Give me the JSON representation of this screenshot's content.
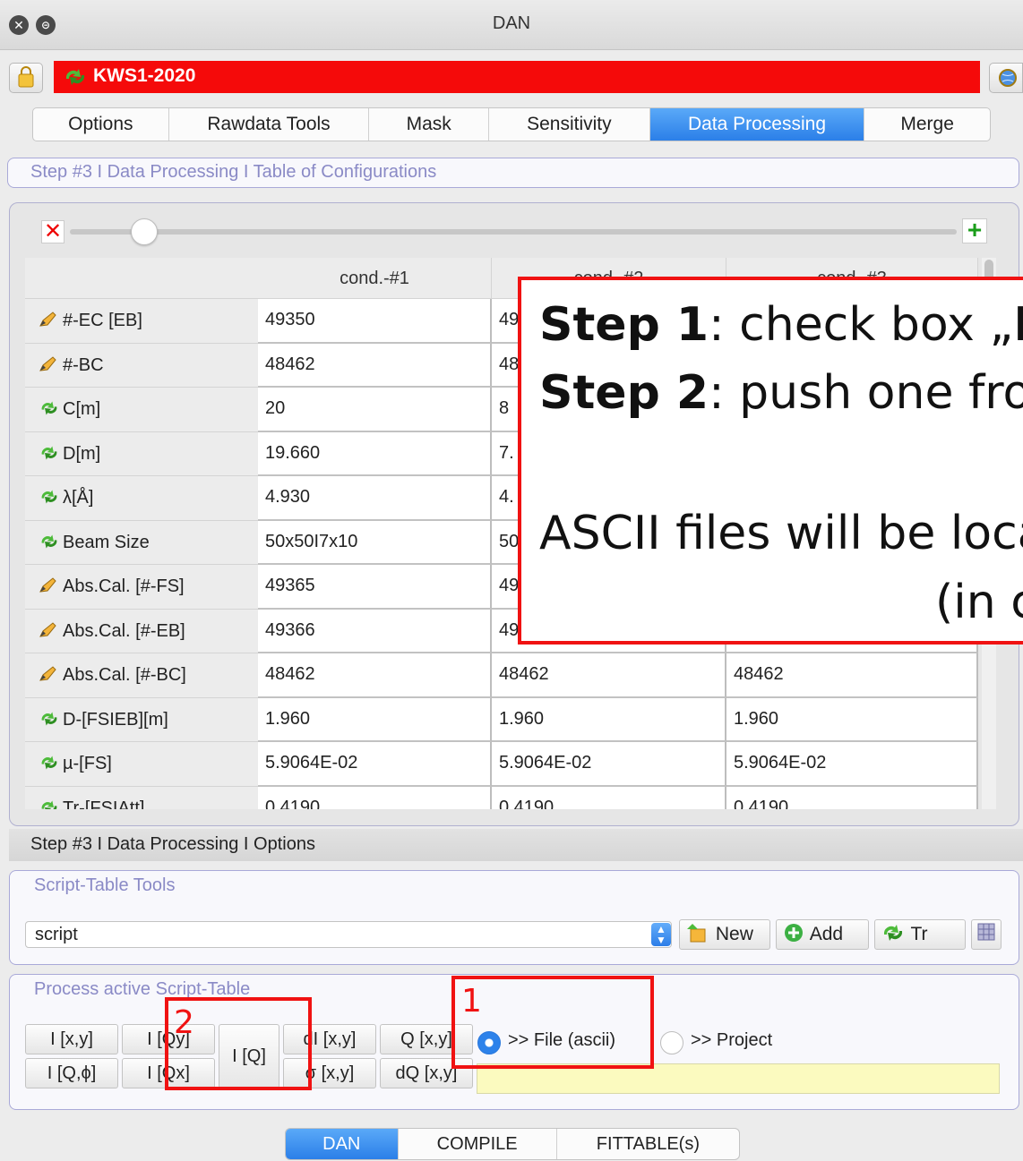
{
  "window": {
    "title": "DAN"
  },
  "project": {
    "name": "KWS1-2020"
  },
  "tabs": [
    {
      "label": "Options",
      "active": false
    },
    {
      "label": "Rawdata Tools",
      "active": false
    },
    {
      "label": "Mask",
      "active": false
    },
    {
      "label": "Sensitivity",
      "active": false
    },
    {
      "label": "Data Processing",
      "active": true
    },
    {
      "label": "Merge",
      "active": false
    }
  ],
  "step_header_table": "Step #3 I Data Processing I Table of Configurations",
  "table": {
    "columns": [
      "cond.-#1",
      "cond.-#2",
      "cond.-#3"
    ],
    "rows": [
      {
        "label": "#-EC [EB]",
        "icon": "pencil-icon",
        "values": [
          "49350",
          "49",
          ""
        ]
      },
      {
        "label": "#-BC",
        "icon": "pencil-icon",
        "values": [
          "48462",
          "48",
          ""
        ]
      },
      {
        "label": "C[m]",
        "icon": "recycle-icon",
        "values": [
          "20",
          "8",
          ""
        ]
      },
      {
        "label": "D[m]",
        "icon": "recycle-icon",
        "values": [
          "19.660",
          "7.",
          ""
        ]
      },
      {
        "label": "λ[Å]",
        "icon": "recycle-icon",
        "values": [
          "4.930",
          "4.",
          ""
        ]
      },
      {
        "label": "Beam Size",
        "icon": "recycle-icon",
        "values": [
          "50x50I7x10",
          "50",
          ""
        ]
      },
      {
        "label": "Abs.Cal. [#-FS]",
        "icon": "pencil-icon",
        "values": [
          "49365",
          "49",
          ""
        ]
      },
      {
        "label": "Abs.Cal. [#-EB]",
        "icon": "pencil-icon",
        "values": [
          "49366",
          "49",
          ""
        ]
      },
      {
        "label": "Abs.Cal. [#-BC]",
        "icon": "pencil-icon",
        "values": [
          "48462",
          "48462",
          "48462"
        ]
      },
      {
        "label": "D-[FSIEB][m]",
        "icon": "recycle-icon",
        "values": [
          "1.960",
          "1.960",
          "1.960"
        ]
      },
      {
        "label": "µ-[FS]",
        "icon": "recycle-icon",
        "values": [
          "5.9064E-02",
          "5.9064E-02",
          "5.9064E-02"
        ]
      },
      {
        "label": "Tr-[FSIAtt]",
        "icon": "recycle-icon",
        "values": [
          "0.4190",
          "0.4190",
          "0.4190"
        ]
      }
    ]
  },
  "step_header_options": "Step #3 I Data Processing I Options",
  "script_tools": {
    "group_label": "Script-Table Tools",
    "script_value": "script",
    "new_label": "New",
    "add_label": "Add",
    "tr_label": "Tr"
  },
  "process": {
    "group_label": "Process active Script-Table",
    "buttons": {
      "i_xy": "I [x,y]",
      "i_qy": "I [Qy]",
      "i_q": "I [Q]",
      "di_xy": "dI [x,y]",
      "q_xy": "Q [x,y]",
      "i_qphi": "I [Q,ϕ]",
      "i_qx": "I [Qx]",
      "sigma_xy": "σ [x,y]",
      "dq_xy": "dQ [x,y]"
    },
    "radio_file": "&gt;&gt; File (ascii)",
    "radio_project": "&gt;&gt; Project",
    "output_path": ""
  },
  "bottom_tabs": [
    {
      "label": "DAN",
      "active": true
    },
    {
      "label": "COMPILE",
      "active": false
    },
    {
      "label": "FITTABLE(s)",
      "active": false
    }
  ],
  "annotation": {
    "step1_bold": "Step 1",
    "step1_text": ": check box „",
    "step1_tail": "Fi",
    "step2_bold": "Step 2",
    "step2_text": ": push one fro",
    "ascii_text": "ASCII files will be loca",
    "paren_text": "(in c",
    "marker1": "1",
    "marker2": "2"
  },
  "colors": {
    "accent_blue": "#2b7fe8",
    "project_red": "#f50a0a",
    "annotation_red": "#f01212",
    "path_yellow": "#fbfabf"
  }
}
